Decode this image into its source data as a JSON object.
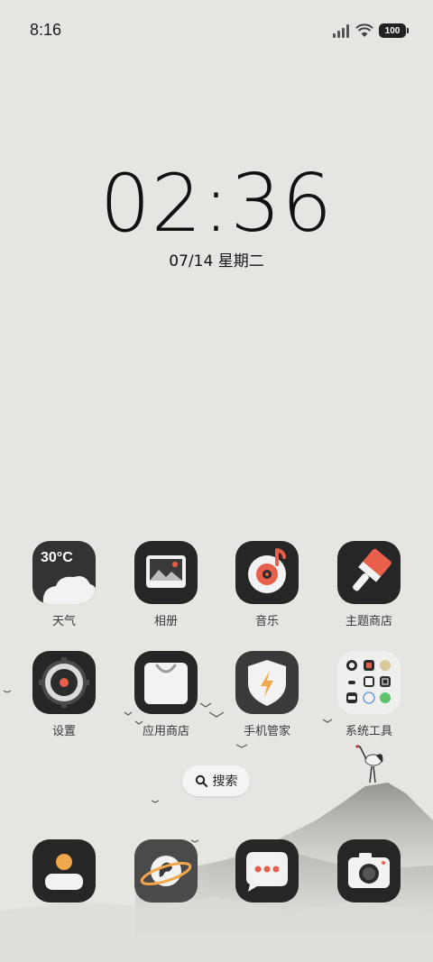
{
  "status_bar": {
    "time": "8:16",
    "battery": "100"
  },
  "lock_clock": {
    "time": "02:36",
    "date": "07/14 星期二"
  },
  "weather_widget": {
    "temperature": "30°C"
  },
  "apps": [
    {
      "label": "天气",
      "icon": "weather-icon"
    },
    {
      "label": "相册",
      "icon": "gallery-icon"
    },
    {
      "label": "音乐",
      "icon": "music-icon"
    },
    {
      "label": "主题商店",
      "icon": "theme-store-icon"
    },
    {
      "label": "设置",
      "icon": "settings-icon"
    },
    {
      "label": "应用商店",
      "icon": "app-store-icon"
    },
    {
      "label": "手机管家",
      "icon": "security-icon"
    },
    {
      "label": "系统工具",
      "icon": "folder-icon"
    }
  ],
  "search": {
    "label": "搜索"
  },
  "dock": [
    {
      "icon": "contacts-icon"
    },
    {
      "icon": "browser-icon"
    },
    {
      "icon": "messages-icon"
    },
    {
      "icon": "camera-icon"
    }
  ],
  "colors": {
    "background": "#e6e5e2",
    "icon_dark": "#262626",
    "accent_red": "#e8604c",
    "accent_orange": "#f0a84a"
  }
}
